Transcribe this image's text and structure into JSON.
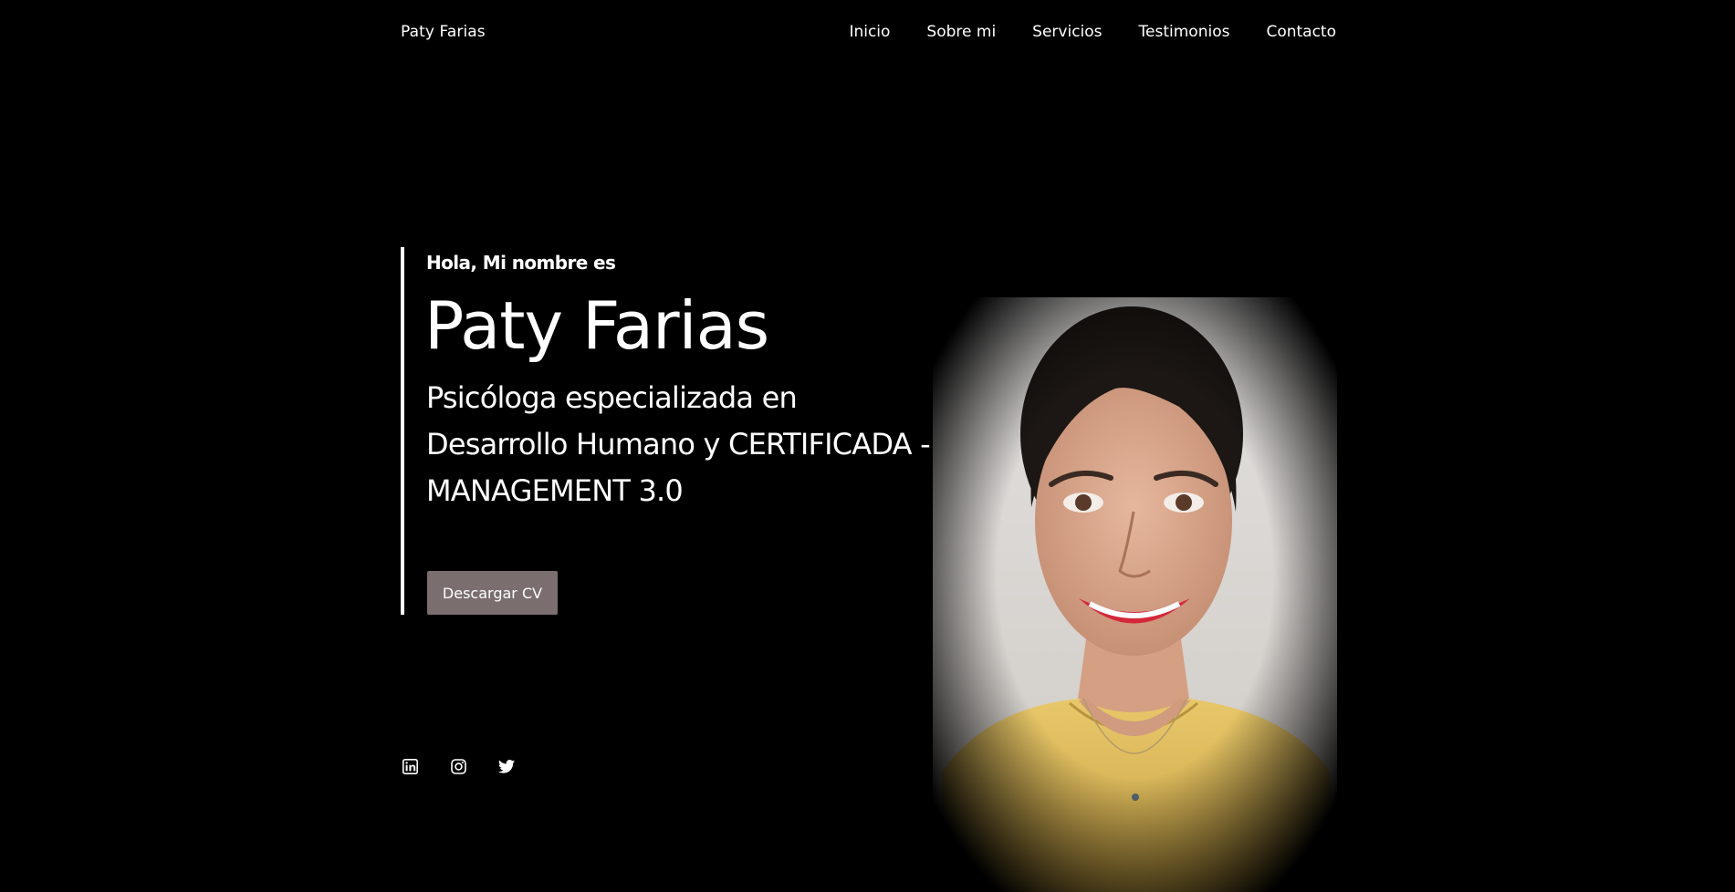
{
  "nav": {
    "brand": "Paty Farias",
    "links": [
      {
        "label": "Inicio"
      },
      {
        "label": "Sobre mi"
      },
      {
        "label": "Servicios"
      },
      {
        "label": "Testimonios"
      },
      {
        "label": "Contacto"
      }
    ]
  },
  "hero": {
    "greeting": "Hola, Mi nombre es",
    "name": "Paty Farias",
    "subtitle": "Psicóloga especializada en Desarrollo Humano y CERTIFICADA - MANAGEMENT 3.0",
    "cv_button": "Descargar CV"
  },
  "social": {
    "icons": [
      "linkedin-icon",
      "instagram-icon",
      "twitter-icon"
    ]
  },
  "colors": {
    "background": "#000000",
    "text": "#ffffff",
    "button": "#7a6e6f"
  }
}
